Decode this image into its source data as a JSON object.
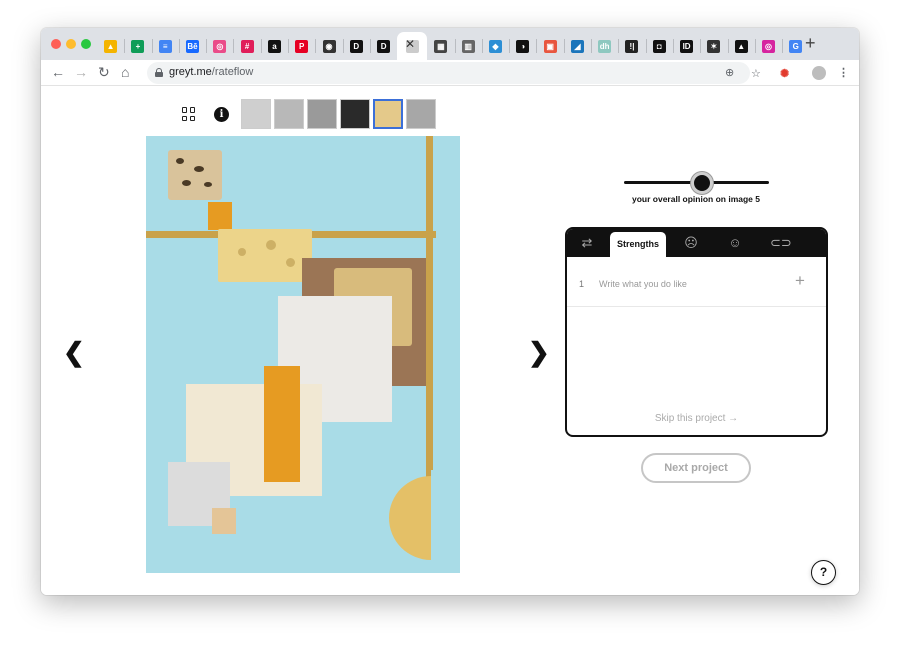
{
  "browser": {
    "tabs": [
      {
        "name": "drive",
        "icon": "google-drive-icon",
        "color": "#f4b400",
        "text": "▲"
      },
      {
        "name": "sheets",
        "icon": "google-sheets-icon",
        "color": "#0f9d58",
        "text": "+"
      },
      {
        "name": "docs",
        "icon": "google-docs-icon",
        "color": "#4285f4",
        "text": "≡"
      },
      {
        "name": "behance",
        "icon": "behance-icon",
        "color": "#1769ff",
        "text": "Bē"
      },
      {
        "name": "dribbble",
        "icon": "dribbble-icon",
        "color": "#ea4c89",
        "text": "◎"
      },
      {
        "name": "slack",
        "icon": "slack-icon",
        "color": "#e01e5a",
        "text": "#"
      },
      {
        "name": "site-7",
        "icon": "circle-logo-icon",
        "color": "#111111",
        "text": "a"
      },
      {
        "name": "pinterest",
        "icon": "pinterest-icon",
        "color": "#e60023",
        "text": "P"
      },
      {
        "name": "site-9",
        "icon": "record-icon",
        "color": "#333333",
        "text": "◉"
      },
      {
        "name": "site-10",
        "icon": "d-logo-icon",
        "color": "#111111",
        "text": "D"
      },
      {
        "name": "site-11",
        "icon": "d-round-icon",
        "color": "#111111",
        "text": "D"
      },
      {
        "name": "greyt",
        "icon": "greyt-icon",
        "color": "#cccccc",
        "text": "·"
      },
      {
        "name": "site-13",
        "icon": "checker-icon",
        "color": "#444444",
        "text": "▦"
      },
      {
        "name": "site-14",
        "icon": "barcode-icon",
        "color": "#666666",
        "text": "▥"
      },
      {
        "name": "site-15",
        "icon": "diamond-icon",
        "color": "#2d8fd5",
        "text": "◆"
      },
      {
        "name": "site-16",
        "icon": "ring-icon",
        "color": "#111111",
        "text": "◑"
      },
      {
        "name": "site-17",
        "icon": "red-square-icon",
        "color": "#e8563f",
        "text": "▣"
      },
      {
        "name": "site-18",
        "icon": "blue-square-icon",
        "color": "#1b75bb",
        "text": "◢"
      },
      {
        "name": "site-19",
        "icon": "dh-icon",
        "color": "#8ec8c0",
        "text": "dh"
      },
      {
        "name": "site-20",
        "icon": "bars-icon",
        "color": "#222222",
        "text": "!|"
      },
      {
        "name": "site-21",
        "icon": "frame-icon",
        "color": "#111111",
        "text": "◘"
      },
      {
        "name": "site-22",
        "icon": "id-icon",
        "color": "#111111",
        "text": "ID"
      },
      {
        "name": "site-23",
        "icon": "runner-icon",
        "color": "#333333",
        "text": "✶"
      },
      {
        "name": "site-24",
        "icon": "mountain-icon",
        "color": "#111111",
        "text": "▲"
      },
      {
        "name": "instagram",
        "icon": "instagram-icon",
        "color": "#d6249f",
        "text": "◎"
      },
      {
        "name": "google",
        "icon": "google-icon",
        "color": "#4285f4",
        "text": "G"
      }
    ],
    "active_tab_index": 11,
    "url_host": "greyt.me",
    "url_path": "/rateflow"
  },
  "gallery": {
    "thumbs": [
      {
        "name": "thumb-1",
        "color": "#cfcfcf"
      },
      {
        "name": "thumb-2",
        "color": "#b8b8b8"
      },
      {
        "name": "thumb-3",
        "color": "#9a9a9a"
      },
      {
        "name": "thumb-4",
        "color": "#2a2a2a"
      },
      {
        "name": "thumb-5",
        "color": "#e4c98a",
        "selected": true
      },
      {
        "name": "thumb-6",
        "color": "#a7a7a7"
      }
    ]
  },
  "rating": {
    "caption": "your overall opinion on image 5",
    "value": 0.54
  },
  "feedback": {
    "active_tab": "Strengths",
    "row_number": "1",
    "placeholder": "Write what you do like",
    "skip_label": "Skip this project →"
  },
  "actions": {
    "next_label": "Next project",
    "help_label": "?"
  }
}
